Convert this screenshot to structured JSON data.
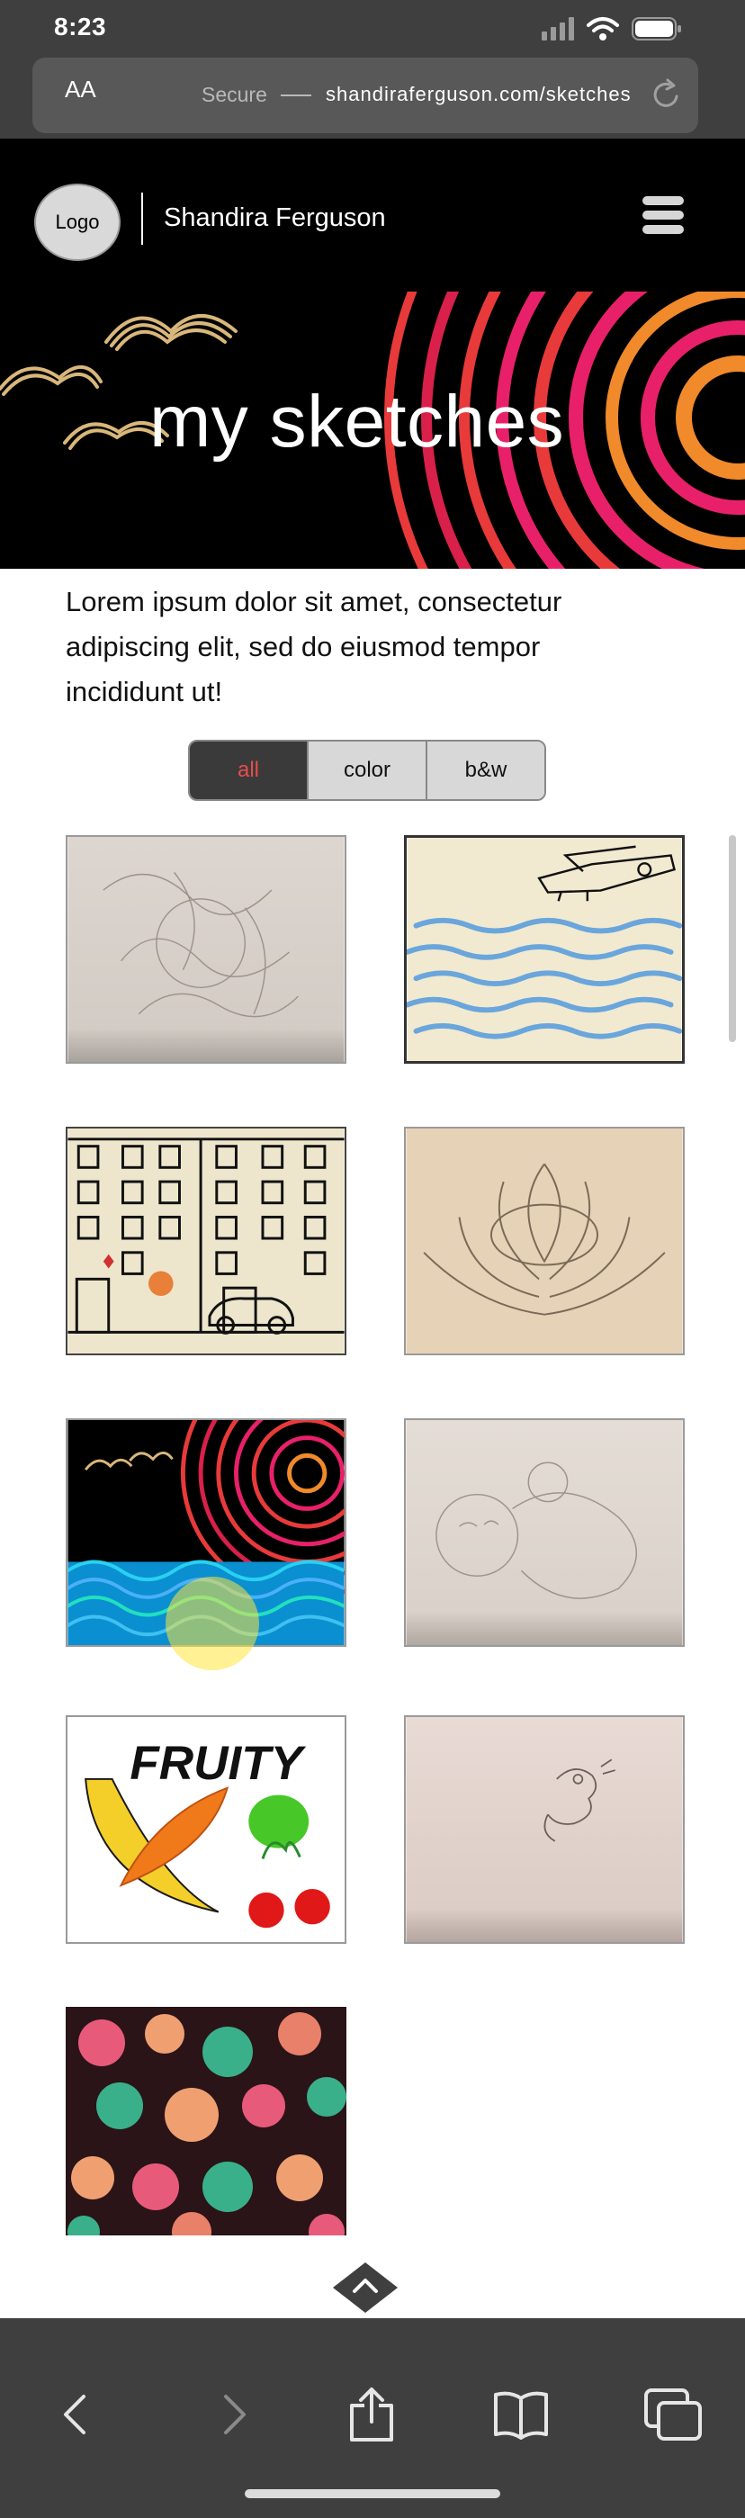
{
  "status": {
    "time": "8:23"
  },
  "browser": {
    "aa_label": "AA",
    "secure_label": "Secure",
    "url": "shandiraferguson.com/sketches"
  },
  "header": {
    "logo_label": "Logo",
    "site_name": "Shandira Ferguson"
  },
  "hero": {
    "title": "my sketches"
  },
  "intro": {
    "text": "Lorem ipsum dolor sit amet, consectetur adipiscing elit, sed do eiusmod tempor incididunt ut!"
  },
  "filter": {
    "options": [
      "all",
      "color",
      "b&w"
    ],
    "selected": "all",
    "selected_color": "#e84d4d"
  },
  "gallery": {
    "items": [
      "pencil-swirl-sketch",
      "plane-over-sea-sketch",
      "building-street-sketch",
      "lotus-flower-sketch",
      "colorful-sun-waves-sketch",
      "baby-pencil-sketch",
      "fruity-illustration",
      "bird-pencil-sketch",
      "floral-pattern"
    ],
    "fruity_text": "FRUITY"
  },
  "colors": {
    "chrome": "#3f3f3f",
    "header_bg": "#000000",
    "accent_red": "#e84d4d",
    "hero_pink": "#e8206a",
    "hero_orange": "#f08a2a"
  }
}
